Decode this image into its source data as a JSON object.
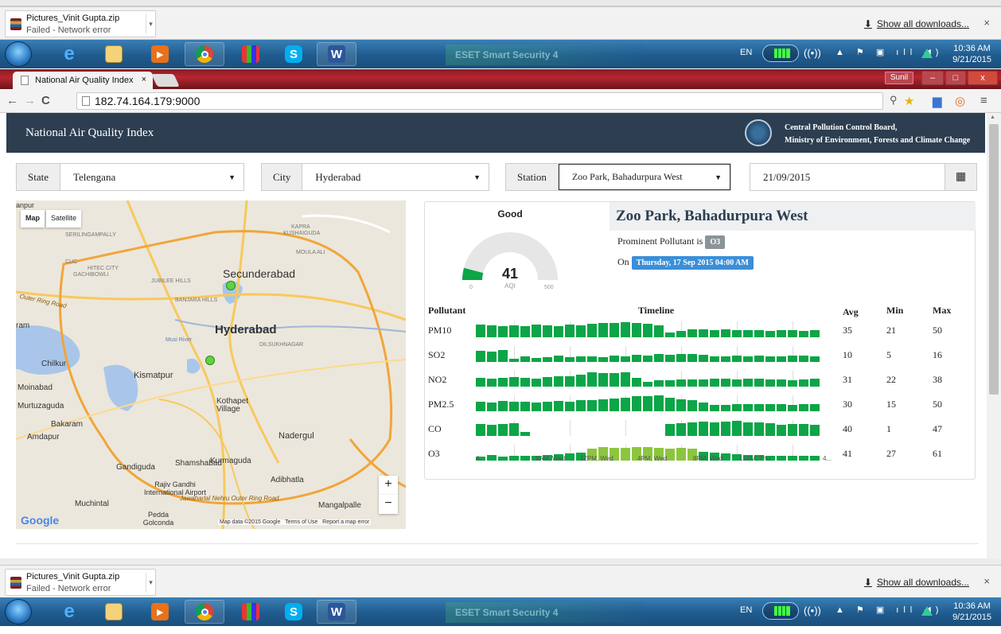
{
  "downloads": {
    "file": "Pictures_Vinit Gupta.zip",
    "status": "Failed - Network error",
    "show_all": "Show all downloads...",
    "close": "×"
  },
  "taskbar": {
    "lang": "EN",
    "time": "10:36 AM",
    "date": "9/21/2015",
    "eset": "ESET Smart Security 4",
    "apps": [
      "start-orb",
      "internet-explorer",
      "file-explorer",
      "media-player",
      "chrome",
      "app-grid",
      "skype",
      "word"
    ]
  },
  "browser": {
    "tab_title": "National Air Quality Index",
    "tab_close": "×",
    "user": "Sunil",
    "url": "182.74.164.179:9000",
    "minimize": "–",
    "maximize": "□",
    "close": "x"
  },
  "header": {
    "title": "National Air Quality Index",
    "org_line1": "Central Pollution Control Board,",
    "org_line2": "Ministry of Environment, Forests and Climate Change"
  },
  "filters": {
    "state_label": "State",
    "state_value": "Telengana",
    "city_label": "City",
    "city_value": "Hyderabad",
    "station_label": "Station",
    "station_value": "Zoo Park, Bahadurpura West",
    "date_value": "21/09/2015"
  },
  "map": {
    "map_btn": "Map",
    "satellite_btn": "Satellite",
    "zoom_in": "+",
    "zoom_out": "−",
    "google": "Google",
    "footer": "Map data ©2015 Google   Terms of Use   Report a map error",
    "labels": [
      "Secunderabad",
      "Hyderabad",
      "SERILINGAMPALLY",
      "KAPRA",
      "KUSHAIGUDA",
      "MOULA ALI",
      "HITEC CITY",
      "GACHIBOWLI",
      "JUBILEE HILLS",
      "BANJARA HILLS",
      "DILSUKHNAGAR",
      "Musi River",
      "Chilkur",
      "Kismatpur",
      "Moinabad",
      "Murtuzaguda",
      "Bakaram",
      "Amdapur",
      "Kothapet Village",
      "Nadergul",
      "Gandiguda",
      "Shamshabad",
      "Kurmaguda",
      "Rajiv Gandhi International Airport",
      "Adibhatla",
      "Muchintal",
      "Pedda Golconda",
      "Mangalpalle",
      "Jawaharlal Nehru Outer Ring Road",
      "Outer Ring Road",
      "CUC",
      "ram",
      "anpur"
    ]
  },
  "aqi": {
    "status": "Good",
    "value": "41",
    "unit": "AQI",
    "min": "0",
    "max": "500",
    "fraction": 0.082,
    "color": "#0ca547"
  },
  "station": {
    "name": "Zoo Park, Bahadurpura West",
    "prominent_label": "Prominent Pollutant is",
    "prominent_value": "O3",
    "on_label": "On",
    "on_value": "Thursday, 17 Sep 2015 04:00 AM"
  },
  "table": {
    "headers": {
      "pollutant": "Pollutant",
      "timeline": "Timeline",
      "avg": "Avg",
      "min": "Min",
      "max": "Max"
    },
    "time_labels": [
      "4...",
      "8AM, Wed",
      "12PM, Wed",
      "4PM, Wed",
      "8PM, Wed",
      "12AM, Thu",
      "4..."
    ],
    "rows": [
      {
        "name": "PM10",
        "avg": "35",
        "min": "21",
        "max": "50",
        "levels": [
          0.8,
          0.75,
          0.7,
          0.75,
          0.7,
          0.8,
          0.75,
          0.7,
          0.8,
          0.75,
          0.85,
          0.9,
          0.9,
          0.95,
          0.9,
          0.85,
          0.75,
          0.3,
          0.4,
          0.5,
          0.5,
          0.45,
          0.5,
          0.45,
          0.45,
          0.45,
          0.4,
          0.45,
          0.45,
          0.4,
          0.45
        ]
      },
      {
        "name": "SO2",
        "avg": "10",
        "min": "5",
        "max": "16",
        "levels": [
          0.7,
          0.65,
          0.75,
          0.2,
          0.35,
          0.25,
          0.3,
          0.4,
          0.3,
          0.35,
          0.35,
          0.3,
          0.4,
          0.35,
          0.45,
          0.4,
          0.5,
          0.45,
          0.5,
          0.5,
          0.45,
          0.35,
          0.35,
          0.4,
          0.35,
          0.4,
          0.35,
          0.35,
          0.4,
          0.4,
          0.35
        ]
      },
      {
        "name": "NO2",
        "avg": "31",
        "min": "22",
        "max": "38",
        "levels": [
          0.55,
          0.5,
          0.55,
          0.6,
          0.55,
          0.5,
          0.6,
          0.65,
          0.65,
          0.75,
          0.9,
          0.85,
          0.85,
          0.9,
          0.55,
          0.3,
          0.4,
          0.4,
          0.45,
          0.45,
          0.45,
          0.5,
          0.5,
          0.45,
          0.5,
          0.5,
          0.45,
          0.45,
          0.4,
          0.45,
          0.5
        ]
      },
      {
        "name": "PM2.5",
        "avg": "30",
        "min": "15",
        "max": "50",
        "levels": [
          0.6,
          0.55,
          0.65,
          0.6,
          0.6,
          0.55,
          0.6,
          0.65,
          0.6,
          0.7,
          0.7,
          0.75,
          0.8,
          0.85,
          0.95,
          0.95,
          1.0,
          0.85,
          0.75,
          0.7,
          0.55,
          0.4,
          0.4,
          0.45,
          0.45,
          0.45,
          0.45,
          0.45,
          0.4,
          0.45,
          0.45
        ]
      },
      {
        "name": "CO",
        "avg": "40",
        "min": "1",
        "max": "47",
        "levels": [
          0.75,
          0.7,
          0.75,
          0.8,
          0.25,
          0.0,
          0.0,
          0.0,
          0.0,
          0.0,
          0.0,
          0.0,
          0.0,
          0.0,
          0.0,
          0.0,
          0.0,
          0.75,
          0.8,
          0.85,
          0.9,
          0.85,
          0.9,
          0.95,
          0.85,
          0.85,
          0.8,
          0.7,
          0.75,
          0.75,
          0.7
        ]
      },
      {
        "name": "O3",
        "avg": "41",
        "min": "27",
        "max": "61",
        "levels": [
          0.25,
          0.35,
          0.25,
          0.3,
          0.3,
          0.3,
          0.35,
          0.4,
          0.45,
          0.5,
          0.75,
          0.85,
          0.8,
          0.8,
          0.85,
          0.85,
          0.8,
          0.75,
          0.8,
          0.75,
          0.55,
          0.5,
          0.45,
          0.4,
          0.35,
          0.35,
          0.3,
          0.3,
          0.3,
          0.3,
          0.3
        ]
      }
    ]
  }
}
